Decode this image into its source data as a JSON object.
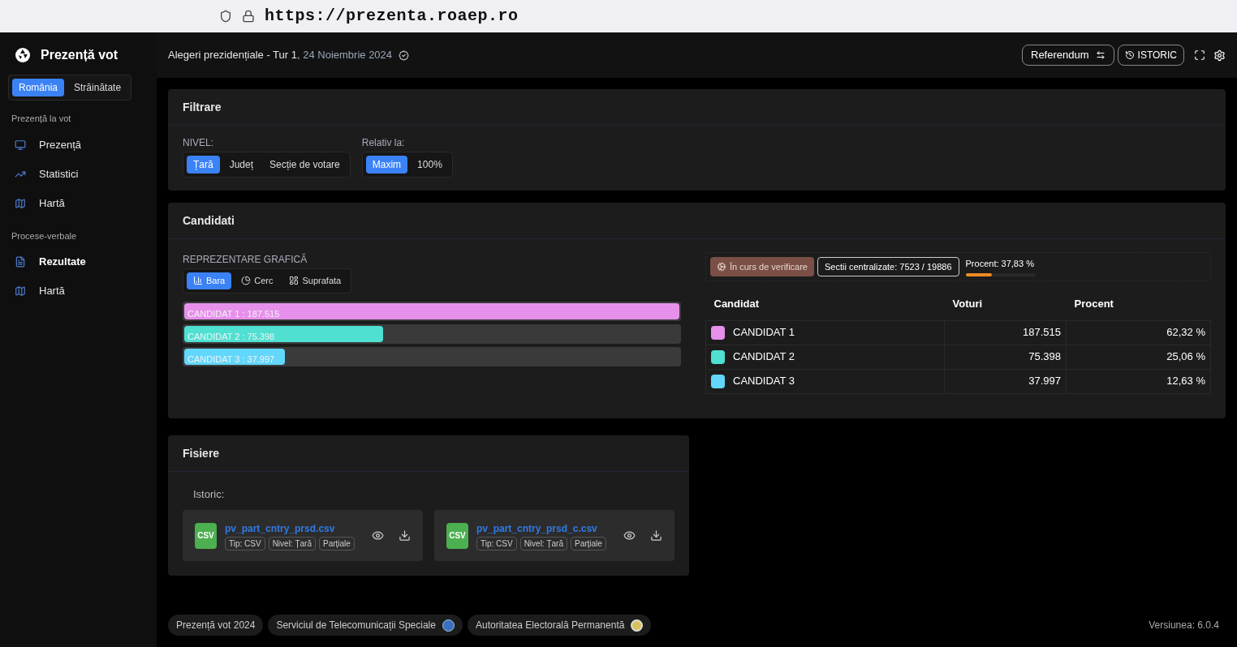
{
  "browser": {
    "url": "https://prezenta.roaep.ro"
  },
  "sidebar": {
    "title": "Prezență vot",
    "scope_tabs": [
      {
        "label": "România",
        "selected": true
      },
      {
        "label": "Străinătate",
        "selected": false
      }
    ],
    "sections": [
      {
        "heading": "Prezență la vot",
        "items": [
          {
            "label": "Prezență",
            "selected": false
          },
          {
            "label": "Statistici",
            "selected": false
          },
          {
            "label": "Hartă",
            "selected": false
          }
        ]
      },
      {
        "heading": "Procese-verbale",
        "items": [
          {
            "label": "Rezultate",
            "selected": true
          },
          {
            "label": "Hartă",
            "selected": false
          }
        ]
      }
    ]
  },
  "header": {
    "title": "Alegeri prezidențiale - Tur 1",
    "date": ", 24 Noiembrie 2024",
    "referendum": "Referendum",
    "history": "ISTORIC"
  },
  "filter": {
    "title": "Filtrare",
    "groups": [
      {
        "label": "NIVEL:",
        "options": [
          {
            "label": "Țară",
            "selected": true
          },
          {
            "label": "Județ",
            "selected": false
          },
          {
            "label": "Secție de votare",
            "selected": false
          }
        ]
      },
      {
        "label": "Relativ la:",
        "options": [
          {
            "label": "Maxim",
            "selected": true
          },
          {
            "label": "100%",
            "selected": false
          }
        ]
      }
    ]
  },
  "candidates": {
    "title": "Candidati",
    "view_label": "REPREZENTARE GRAFICĂ",
    "views": [
      {
        "label": "Bara",
        "selected": true
      },
      {
        "label": "Cerc",
        "selected": false
      },
      {
        "label": "Suprafata",
        "selected": false
      }
    ],
    "bars": [
      {
        "label": "CANDIDAT 1 : 187.515",
        "level": 1,
        "color": "#e690ec"
      },
      {
        "label": "CANDIDAT 2 : 75.398",
        "level": 0.402,
        "color": "#4fe0d2"
      },
      {
        "label": "CANDIDAT 3 : 37.997",
        "level": 0.203,
        "color": "#63d6fb"
      }
    ],
    "status": "În curs de verificare",
    "centralized": "Sectii centralizate: 7523 / 19886",
    "percent": {
      "label": "Procent: 37,83 %",
      "level": 0.3783
    },
    "table": {
      "columns": [
        "Candidat",
        "Voturi",
        "Procent"
      ],
      "rows": [
        {
          "name": "CANDIDAT 1",
          "color": "#e690ec",
          "votes": "187.515",
          "percent": "62,32 %"
        },
        {
          "name": "CANDIDAT 2",
          "color": "#4fe0d2",
          "votes": "75.398",
          "percent": "25,06 %"
        },
        {
          "name": "CANDIDAT 3",
          "color": "#63d6fb",
          "votes": "37.997",
          "percent": "12,63 %"
        }
      ]
    }
  },
  "files": {
    "title": "Fisiere",
    "subtitle": "Istoric:",
    "items": [
      {
        "badge": "CSV",
        "name": "pv_part_cntry_prsd.csv",
        "tags": [
          "Tip: CSV",
          "Nivel: Țară",
          "Parțiale"
        ]
      },
      {
        "badge": "CSV",
        "name": "pv_part_cntry_prsd_c.csv",
        "tags": [
          "Tip: CSV",
          "Nivel: Țară",
          "Parțiale"
        ]
      }
    ]
  },
  "footer": {
    "chips": [
      "Prezență vot 2024",
      "Serviciul de Telecomunicații Speciale",
      "Autoritatea Electorală Permanentă"
    ],
    "version": "Versiunea: 6.0.4"
  }
}
